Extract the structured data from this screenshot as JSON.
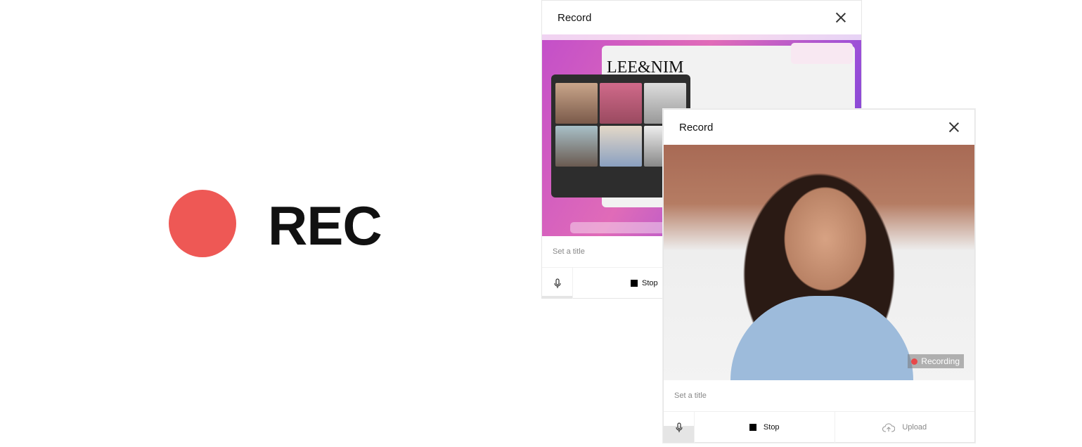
{
  "hero": {
    "label": "REC",
    "dot_color": "#EE5855"
  },
  "panel_back": {
    "title": "Record",
    "screen_logo": "LEE&NIM",
    "title_placeholder": "Set a title",
    "stop_label": "Stop",
    "mic_level": 0.1
  },
  "panel_front": {
    "title": "Record",
    "recording_badge": "Recording",
    "recording_color": "#E8484A",
    "title_placeholder": "Set a title",
    "stop_label": "Stop",
    "upload_label": "Upload",
    "mic_level": 0.55
  }
}
